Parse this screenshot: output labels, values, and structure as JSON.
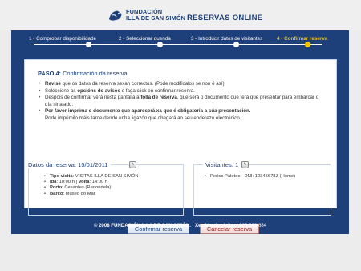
{
  "header": {
    "org_line1": "FUNDACIÓN",
    "org_line2": "ILLA DE SAN SIMÓN",
    "title": "RESERVAS ONLINE"
  },
  "steps": [
    {
      "label": "1 - Comprobar disponibilidade",
      "active": false
    },
    {
      "label": "2 - Seleccionar quenda",
      "active": false
    },
    {
      "label": "3 - Introducir datos de visitantes",
      "active": false
    },
    {
      "label": "4 - Confirmar reserva",
      "active": true
    }
  ],
  "paso": {
    "label": "PASO 4:",
    "title": "Confirmación da reserva."
  },
  "bullets": {
    "b1_bold": "Revise",
    "b1_rest": " que os datos da reserva sexan correctos. (Pode modificalos se non é así)",
    "b2_pre": "Seleccione as ",
    "b2_bold": "opcións de avisos",
    "b2_post": " e faga click en confirmar reserva.",
    "b3_pre": "Despois de confirmar verá nesta pantalla a ",
    "b3_bold": "folla de reserva",
    "b3_post": ", que será o documento que terá que presentar para embarcar o día sinalado.",
    "b4_bold": "Por favor imprima o documento que aparecerá xa que é obligatoria a súa presentación.",
    "b4_rest": "Pode imprimilo máis tarde dende unha ligazón que chegará ao seu enderezo electrónico."
  },
  "reservation": {
    "title": "Datos da reserva. 15/01/2011",
    "tipo_label": "Tipo visita",
    "tipo_value": ": VISITAS ILLA DE SAN SIMÓN",
    "ida_label": "Ida",
    "ida_value": ": 10:00 h",
    "volta_label": "Volta",
    "volta_value": ": 14:00 h",
    "porto_label": "Porto",
    "porto_value": ": Cesantes (Redondela)",
    "barco_label": "Barco",
    "barco_value": ": Museo do Mar"
  },
  "visitors": {
    "title": "Visitantes: 1",
    "list": [
      "Perico Palotes - DNI: 12345678Z (Home)"
    ]
  },
  "buttons": {
    "confirm": "Confirmar reserva",
    "cancel": "Cancelar reserva"
  },
  "footer": {
    "copyright": "© 2008 FUNDACIÓN ILLA DE SAN SIMÓN.",
    "contact_label": "Xestión de visitas:",
    "phone": "986 903 884"
  },
  "colors": {
    "brand": "#1d3f7a",
    "active_step": "#f2c200"
  }
}
